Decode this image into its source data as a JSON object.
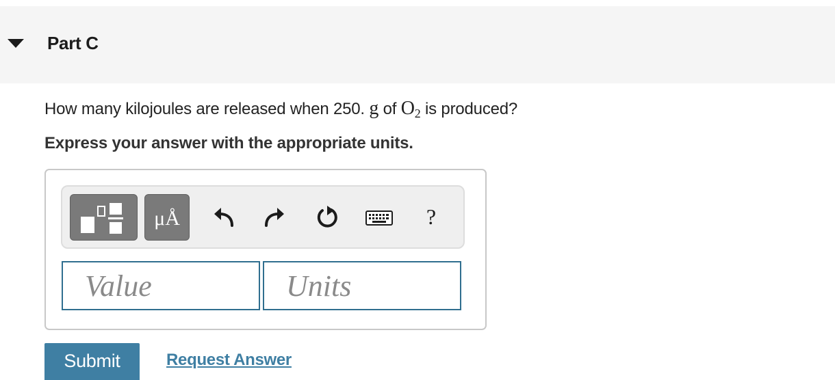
{
  "header": {
    "title": "Part C",
    "toggle_icon": "caret-down-icon"
  },
  "question": {
    "prefix": "How many kilojoules are released when 250. ",
    "unit": "g",
    "middle": " of ",
    "species": "O",
    "subscript": "2",
    "suffix": " is produced?"
  },
  "instruction": "Express your answer with the appropriate units.",
  "toolbar": {
    "template_icon": "templates-icon",
    "units_label": "μÅ",
    "undo_icon": "undo-icon",
    "redo_icon": "redo-icon",
    "reset_icon": "reset-icon",
    "keyboard_icon": "keyboard-icon",
    "help_label": "?"
  },
  "inputs": {
    "value": "",
    "value_placeholder": "Value",
    "units": "",
    "units_placeholder": "Units"
  },
  "actions": {
    "submit_label": "Submit",
    "request_answer_label": "Request Answer"
  },
  "colors": {
    "accent": "#3f7fa3",
    "input_border": "#2f6e8f",
    "header_bg": "#f5f5f5",
    "toolbar_button": "#7a7a7a"
  }
}
